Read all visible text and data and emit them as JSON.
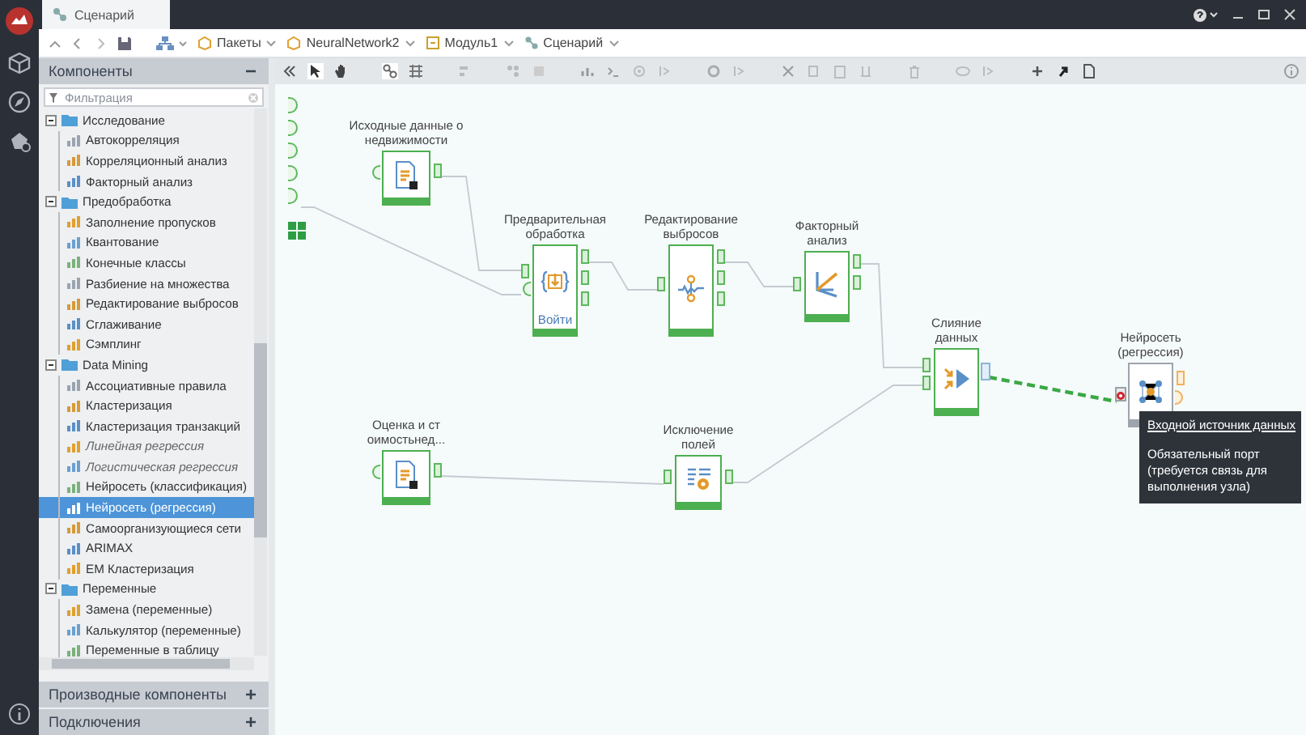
{
  "window": {
    "title": "Сценарий"
  },
  "breadcrumbs": [
    {
      "label": "Пакеты",
      "kind": "package"
    },
    {
      "label": "NeuralNetwork2",
      "kind": "package"
    },
    {
      "label": "Модуль1",
      "kind": "module"
    },
    {
      "label": "Сценарий",
      "kind": "scenario"
    }
  ],
  "sidebar": {
    "title": "Компоненты",
    "filter": {
      "placeholder": "Фильтрация"
    },
    "tree": [
      {
        "label": "Исследование",
        "expanded": true,
        "children": [
          {
            "label": "Автокорреляция",
            "selected": false,
            "disabled": false
          },
          {
            "label": "Корреляционный анализ",
            "selected": false,
            "disabled": false
          },
          {
            "label": "Факторный анализ",
            "selected": false,
            "disabled": false
          }
        ]
      },
      {
        "label": "Предобработка",
        "expanded": true,
        "children": [
          {
            "label": "Заполнение пропусков",
            "selected": false,
            "disabled": false
          },
          {
            "label": "Квантование",
            "selected": false,
            "disabled": false
          },
          {
            "label": "Конечные классы",
            "selected": false,
            "disabled": false
          },
          {
            "label": "Разбиение на множества",
            "selected": false,
            "disabled": false
          },
          {
            "label": "Редактирование выбросов",
            "selected": false,
            "disabled": false
          },
          {
            "label": "Сглаживание",
            "selected": false,
            "disabled": false
          },
          {
            "label": "Сэмплинг",
            "selected": false,
            "disabled": false
          }
        ]
      },
      {
        "label": "Data Mining",
        "expanded": true,
        "children": [
          {
            "label": "Ассоциативные правила",
            "selected": false,
            "disabled": false
          },
          {
            "label": "Кластеризация",
            "selected": false,
            "disabled": false
          },
          {
            "label": "Кластеризация транзакций",
            "selected": false,
            "disabled": false
          },
          {
            "label": "Линейная регрессия",
            "selected": false,
            "disabled": true
          },
          {
            "label": "Логистическая регрессия",
            "selected": false,
            "disabled": true
          },
          {
            "label": "Нейросеть (классификация)",
            "selected": false,
            "disabled": false
          },
          {
            "label": "Нейросеть (регрессия)",
            "selected": true,
            "disabled": false
          },
          {
            "label": "Самоорганизующиеся сети",
            "selected": false,
            "disabled": false
          },
          {
            "label": "ARIMAX",
            "selected": false,
            "disabled": false
          },
          {
            "label": "EM Кластеризация",
            "selected": false,
            "disabled": false
          }
        ]
      },
      {
        "label": "Переменные",
        "expanded": true,
        "children": [
          {
            "label": "Замена (переменные)",
            "selected": false,
            "disabled": false
          },
          {
            "label": "Калькулятор (переменные)",
            "selected": false,
            "disabled": false
          },
          {
            "label": "Переменные в таблицу",
            "selected": false,
            "disabled": false
          }
        ]
      }
    ],
    "panels": [
      {
        "label": "Производные компоненты"
      },
      {
        "label": "Подключения"
      }
    ]
  },
  "canvas": {
    "nodes": [
      {
        "label": "Исходные данные о\nнедвижимости",
        "kind": "file",
        "configured": true
      },
      {
        "label": "Предварительная\nобработка",
        "kind": "preprocess",
        "configured": true,
        "action": "Войти"
      },
      {
        "label": "Редактирование\nвыбросов",
        "kind": "outliers",
        "configured": true
      },
      {
        "label": "Факторный\nанализ",
        "kind": "factor",
        "configured": true
      },
      {
        "label": "Слияние\nданных",
        "kind": "merge",
        "configured": true
      },
      {
        "label": "Нейросеть\n(регрессия)",
        "kind": "neural",
        "configured": false
      },
      {
        "label": "Оценка и ст\nоимостьнед...",
        "kind": "file",
        "configured": true
      },
      {
        "label": "Исключение\nполей",
        "kind": "exclude",
        "configured": true
      }
    ],
    "connections": [
      {
        "kind": "link"
      },
      {
        "kind": "link"
      },
      {
        "kind": "link"
      },
      {
        "kind": "link"
      },
      {
        "kind": "link"
      },
      {
        "kind": "link"
      },
      {
        "kind": "link"
      },
      {
        "kind": "pending"
      }
    ],
    "tooltip": {
      "title": "Входной источник данных",
      "text": "Обязательный порт (требуется связь для выполнения узла)"
    }
  }
}
